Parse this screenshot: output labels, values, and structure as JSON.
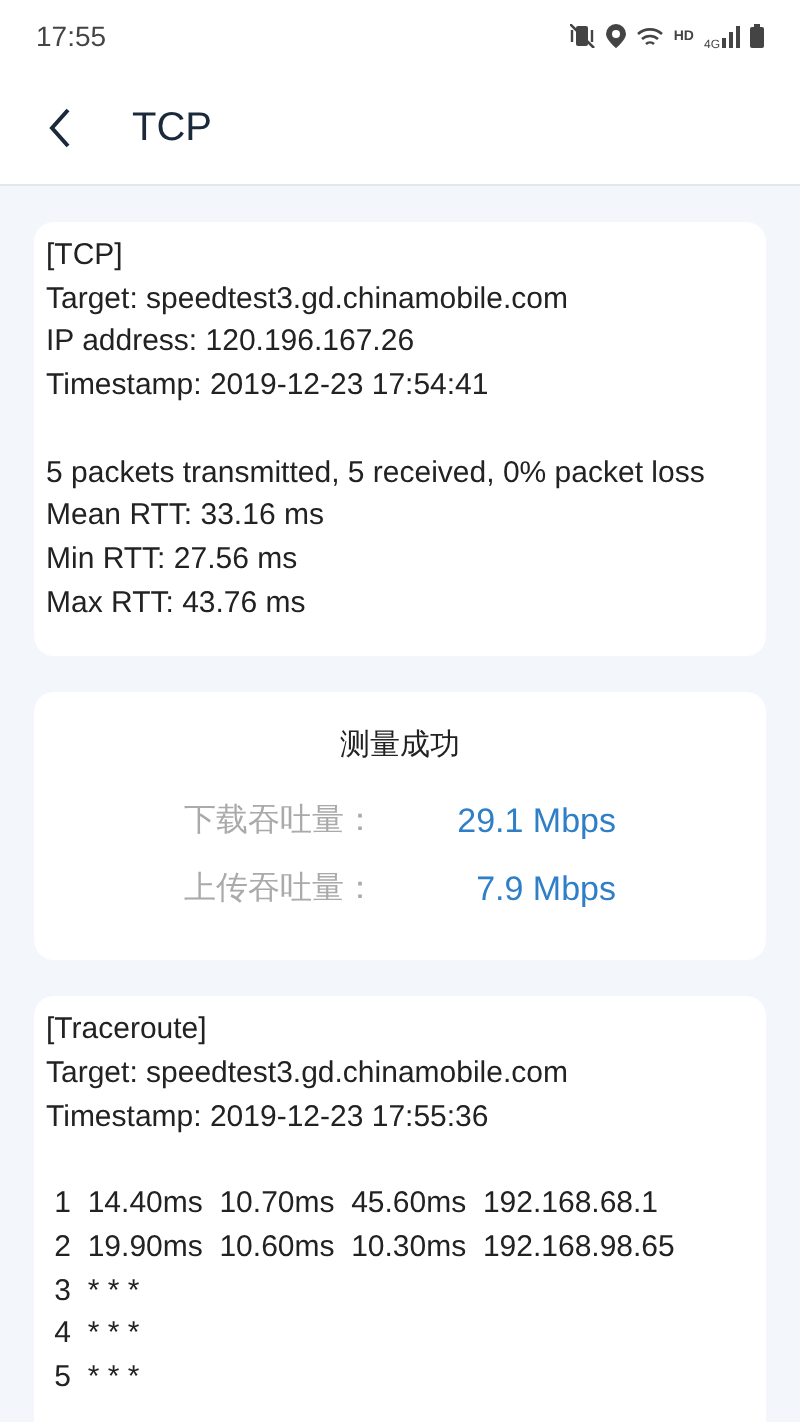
{
  "status_bar": {
    "time": "17:55",
    "hd": "HD",
    "network": "4G"
  },
  "header": {
    "title": "TCP"
  },
  "tcp_card": {
    "groups": [
      [
        "[TCP]",
        "Target: speedtest3.gd.chinamobile.com",
        "IP address: 120.196.167.26",
        "Timestamp: 2019-12-23 17:54:41"
      ],
      [
        "5 packets transmitted, 5 received, 0% packet loss",
        "Mean RTT: 33.16 ms",
        "Min RTT:  27.56 ms",
        "Max RTT:  43.76 ms"
      ]
    ]
  },
  "result_card": {
    "title": "测量成功",
    "rows": [
      {
        "label": "下载吞吐量：",
        "value": "29.1 Mbps"
      },
      {
        "label": "上传吞吐量：",
        "value": "7.9 Mbps"
      }
    ]
  },
  "traceroute_card": {
    "groups": [
      [
        "[Traceroute]",
        "Target: speedtest3.gd.chinamobile.com",
        "Timestamp: 2019-12-23 17:55:36"
      ],
      [
        " 1  14.40ms  10.70ms  45.60ms  192.168.68.1",
        " 2  19.90ms  10.60ms  10.30ms  192.168.98.65",
        " 3  * * *",
        " 4  * * *",
        " 5  * * *"
      ]
    ]
  }
}
